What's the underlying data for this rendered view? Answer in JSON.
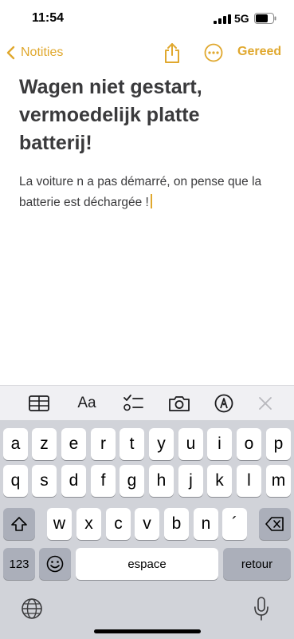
{
  "status_bar": {
    "time": "11:54",
    "network": "5G"
  },
  "nav": {
    "back_label": "Notities",
    "done_label": "Gereed"
  },
  "note": {
    "title": "Wagen niet gestart, vermoedelijk platte batterij!",
    "body": "La voiture n a pas démarré, on pense que la batterie est déchargée !"
  },
  "toolbar": {
    "format_label": "Aa",
    "icons": [
      "table-icon",
      "format-icon",
      "checklist-icon",
      "camera-icon",
      "markup-icon",
      "close-icon"
    ]
  },
  "keyboard": {
    "row1": [
      "a",
      "z",
      "e",
      "r",
      "t",
      "y",
      "u",
      "i",
      "o",
      "p"
    ],
    "row2": [
      "q",
      "s",
      "d",
      "f",
      "g",
      "h",
      "j",
      "k",
      "l",
      "m"
    ],
    "row3": [
      "w",
      "x",
      "c",
      "v",
      "b",
      "n",
      "´"
    ],
    "numbers_label": "123",
    "space_label": "espace",
    "return_label": "retour"
  },
  "colors": {
    "accent": "#e0a82e",
    "keyboard_bg": "#d1d3d9",
    "toolbar_bg": "#f0f0f3"
  }
}
